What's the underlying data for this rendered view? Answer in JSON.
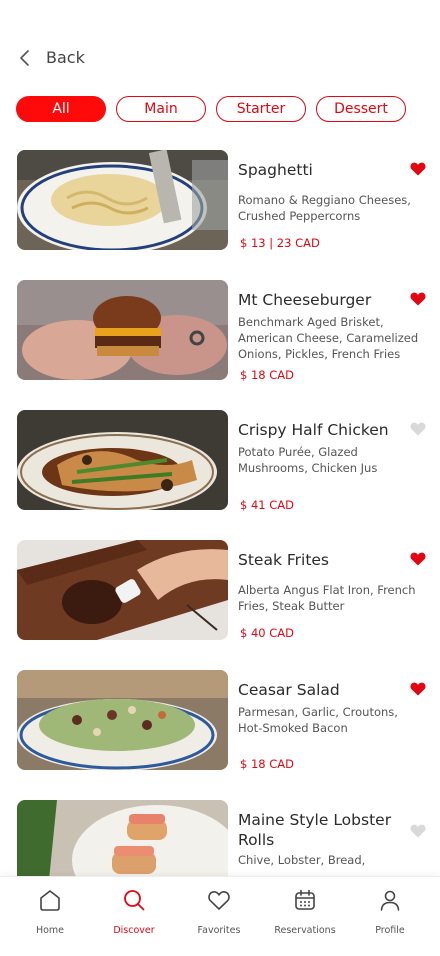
{
  "header": {
    "back_label": "Back"
  },
  "filters": [
    {
      "label": "All",
      "active": true
    },
    {
      "label": "Main",
      "active": false
    },
    {
      "label": "Starter",
      "active": false
    },
    {
      "label": "Dessert",
      "active": false
    }
  ],
  "menu_items": [
    {
      "name": "Spaghetti",
      "description": "Romano & Reggiano Cheeses, Crushed Peppercorns",
      "price": "$ 13 | 23 CAD",
      "favorited": true,
      "image": "spaghetti-photo"
    },
    {
      "name": "Mt Cheeseburger",
      "description": "Benchmark Aged Brisket, American Cheese, Caramelized Onions, Pickles, French Fries",
      "price": "$ 18 CAD",
      "favorited": true,
      "image": "cheeseburger-photo"
    },
    {
      "name": "Crispy Half Chicken",
      "description": "Potato Purée, Glazed Mushrooms, Chicken Jus",
      "price": "$ 41 CAD",
      "favorited": false,
      "image": "chicken-photo"
    },
    {
      "name": "Steak Frites",
      "description": "Alberta Angus Flat Iron, French Fries, Steak Butter",
      "price": "$ 40 CAD",
      "favorited": true,
      "image": "steak-photo"
    },
    {
      "name": "Ceasar Salad",
      "description": "Parmesan, Garlic, Croutons, Hot-Smoked Bacon",
      "price": "$ 18 CAD",
      "favorited": true,
      "image": "salad-photo"
    },
    {
      "name": "Maine Style Lobster Rolls",
      "description": "Chive, Lobster, Bread,",
      "price": "",
      "favorited": false,
      "image": "lobster-roll-photo"
    }
  ],
  "tabbar": [
    {
      "label": "Home",
      "icon": "home-icon",
      "active": false
    },
    {
      "label": "Discover",
      "icon": "search-icon",
      "active": true
    },
    {
      "label": "Favorites",
      "icon": "heart-icon",
      "active": false
    },
    {
      "label": "Reservations",
      "icon": "calendar-icon",
      "active": false
    },
    {
      "label": "Profile",
      "icon": "user-icon",
      "active": false
    }
  ],
  "colors": {
    "accent": "#e30613",
    "heart_active": "#e30613",
    "heart_inactive": "#d9d9d9"
  }
}
